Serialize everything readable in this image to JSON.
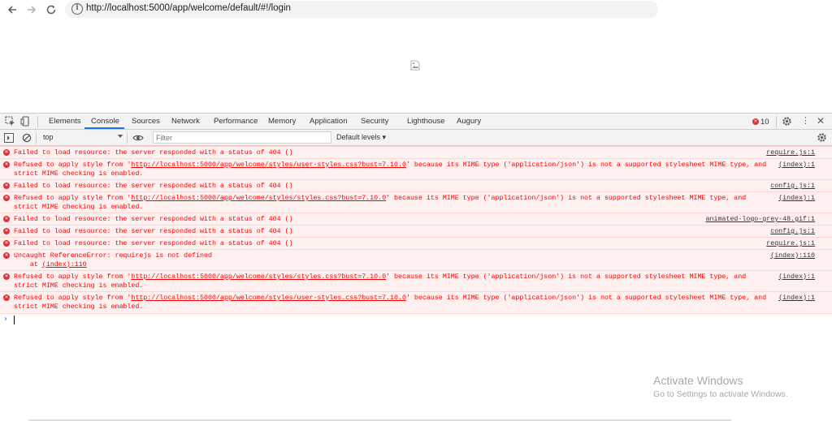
{
  "browser": {
    "url": "http://localhost:5000/app/welcome/default/#!/login",
    "back_icon": "arrow-left-icon",
    "forward_icon": "arrow-right-icon",
    "reload_icon": "reload-icon",
    "info_icon": "info-circle-icon"
  },
  "devtools": {
    "tabs": [
      {
        "label": "Elements"
      },
      {
        "label": "Console",
        "active": true
      },
      {
        "label": "Sources"
      },
      {
        "label": "Network"
      },
      {
        "label": "Performance"
      },
      {
        "label": "Memory"
      },
      {
        "label": "Application"
      },
      {
        "label": "Security"
      },
      {
        "label": "Lighthouse"
      },
      {
        "label": "Augury"
      }
    ],
    "error_count": "10",
    "context": "top",
    "filter_placeholder": "Filter",
    "levels_label": "Default levels ▾"
  },
  "console": {
    "messages": [
      {
        "text": "Failed to load resource: the server responded with a status of 404 ()",
        "source": "require.js:1"
      },
      {
        "pre": "Refused to apply style from '",
        "link": "http://localhost:5000/app/welcome/styles/user-styles.css?bust=7.10.0",
        "post": "' because its MIME type ('application/json') is not a supported stylesheet MIME type, and strict MIME checking is enabled.",
        "source": "(index):1"
      },
      {
        "text": "Failed to load resource: the server responded with a status of 404 ()",
        "source": "config.js:1"
      },
      {
        "pre": "Refused to apply style from '",
        "link": "http://localhost:5000/app/welcome/styles/styles.css?bust=7.10.0",
        "post": "' because its MIME type ('application/json') is not a supported stylesheet MIME type, and strict MIME checking is enabled.",
        "source": "(index):1"
      },
      {
        "text": "Failed to load resource: the server responded with a status of 404 ()",
        "source": "animated-logo-grey-48.gif:1"
      },
      {
        "text": "Failed to load resource: the server responded with a status of 404 ()",
        "source": "config.js:1"
      },
      {
        "text": "Failed to load resource: the server responded with a status of 404 ()",
        "source": "require.js:1"
      },
      {
        "text": "Uncaught ReferenceError: requirejs is not defined",
        "stack_pre": "    at ",
        "stack_link": "(index):110",
        "source": "(index):110"
      },
      {
        "pre": "Refused to apply style from '",
        "link": "http://localhost:5000/app/welcome/styles/styles.css?bust=7.10.0",
        "post": "' because its MIME type ('application/json') is not a supported stylesheet MIME type, and strict MIME checking is enabled.",
        "source": "(index):1"
      },
      {
        "pre": "Refused to apply style from '",
        "link": "http://localhost:5000/app/welcome/styles/user-styles.css?bust=7.10.0",
        "post": "' because its MIME type ('application/json') is not a supported stylesheet MIME type, and strict MIME checking is enabled.",
        "source": "(index):1"
      }
    ]
  },
  "watermark": {
    "title": "Activate Windows",
    "subtitle": "Go to Settings to activate Windows."
  }
}
